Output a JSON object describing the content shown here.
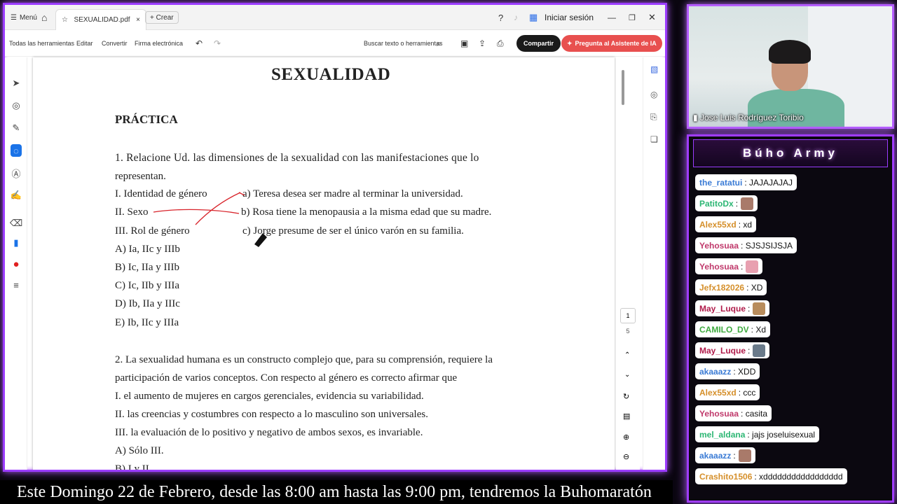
{
  "app": {
    "menu_label": "Menú",
    "tab_title": "SEXUALIDAD.pdf",
    "create_label": "+ Crear",
    "signin_label": "Iniciar sesión"
  },
  "toolbar": {
    "all_tools": "Todas las herramientas",
    "edit": "Editar",
    "convert": "Convertir",
    "esign": "Firma electrónica",
    "search_placeholder": "Buscar texto o herramientas",
    "share": "Compartir",
    "ai_assistant": "Pregunta al Asistente de IA"
  },
  "pager": {
    "current": "1",
    "total": "5"
  },
  "document": {
    "title": "SEXUALIDAD",
    "section": "PRÁCTICA",
    "q1_line1": "1. Relacione Ud. las dimensiones de la sexualidad con las manifestaciones que lo",
    "q1_line2": "representan.",
    "left_items": [
      "I. Identidad de género",
      "II. Sexo",
      "III. Rol de género"
    ],
    "right_items": [
      "a) Teresa desea ser madre al terminar la universidad.",
      "b) Rosa tiene la menopausia a la misma edad que su madre.",
      "c) Jorge presume de ser el único varón en su familia."
    ],
    "q1_options": [
      "A) Ia, IIc y IIIb",
      "B) Ic, IIa y IIIb",
      "C) Ic, IIb y IIIa",
      "D) Ib, IIa y IIIc",
      "E) Ib, IIc y IIIa"
    ],
    "q2_line1": "2. La sexualidad humana es un constructo complejo que, para su comprensión, requiere la",
    "q2_line2": "participación de varios conceptos. Con respecto al género es correcto afirmar que",
    "q2_items": [
      "I. el aumento de mujeres en cargos gerenciales, evidencia su variabilidad.",
      "II. las creencias y costumbres con respecto a lo masculino son universales.",
      "III. la evaluación de lo positivo y negativo de ambos sexos, es invariable."
    ],
    "q2_options": [
      "A) Sólo III.",
      "B) I y II."
    ]
  },
  "webcam": {
    "name": "Jose Luis Rodríguez Toribio"
  },
  "chat": {
    "title": "Búho Army",
    "messages": [
      {
        "user": "the_ratatui",
        "text": ": JAJAJAJAJ",
        "color": "#3a7bd5",
        "emote": ""
      },
      {
        "user": "PatitoDx",
        "text": ":",
        "color": "#2bb673",
        "emote": "#a97a6a"
      },
      {
        "user": "Alex55xd",
        "text": ": xd",
        "color": "#d58f2a",
        "emote": ""
      },
      {
        "user": "Yehosuaa",
        "text": ": SJSJSIJSJA",
        "color": "#c0396b",
        "emote": ""
      },
      {
        "user": "Yehosuaa",
        "text": ":",
        "color": "#c0396b",
        "emote": "#e8a0b0"
      },
      {
        "user": "Jefx182026",
        "text": ": XD",
        "color": "#d58f2a",
        "emote": ""
      },
      {
        "user": "May_Luque",
        "text": ":",
        "color": "#b01b4a",
        "emote": "#b88c5c"
      },
      {
        "user": "CAMILO_DV",
        "text": ": Xd",
        "color": "#3faa3f",
        "emote": ""
      },
      {
        "user": "May_Luque",
        "text": ":",
        "color": "#b01b4a",
        "emote": "#6a7a8a"
      },
      {
        "user": "akaaazz",
        "text": ": XDD",
        "color": "#3a7bd5",
        "emote": ""
      },
      {
        "user": "Alex55xd",
        "text": ": ccc",
        "color": "#d58f2a",
        "emote": ""
      },
      {
        "user": "Yehosuaa",
        "text": ": casita",
        "color": "#c0396b",
        "emote": ""
      },
      {
        "user": "mel_aldana",
        "text": ": jajs joseluisexual",
        "color": "#2bb673",
        "emote": ""
      },
      {
        "user": "akaaazz",
        "text": ":",
        "color": "#3a7bd5",
        "emote": "#a97a6a"
      },
      {
        "user": "Crashito1506",
        "text": ": xddddddddddddddddd",
        "color": "#d58f2a",
        "emote": ""
      }
    ]
  },
  "ticker": "Este Domingo 22 de Febrero, desde las 8:00 am hasta las 9:00 pm, tendremos la Buhomaratón"
}
